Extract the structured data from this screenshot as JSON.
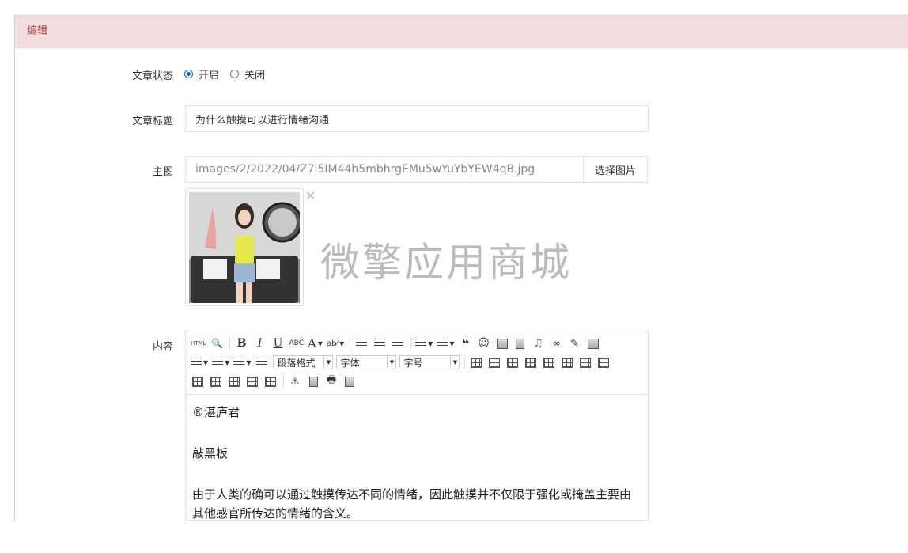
{
  "panel": {
    "title": "编辑"
  },
  "form": {
    "status": {
      "label": "文章状态",
      "options": [
        "开启",
        "关闭"
      ],
      "selected": "开启"
    },
    "title": {
      "label": "文章标题",
      "value": "为什么触摸可以进行情绪沟通"
    },
    "image": {
      "label": "主图",
      "path": "images/2/2022/04/Z7i5IM44h5mbhrgEMu5wYuYbYEW4qB.jpg",
      "choose_label": "选择图片",
      "watermark": "微擎应用商城"
    },
    "content": {
      "label": "内容",
      "toolbar": {
        "paragraph_format": "段落格式",
        "font_family": "字体",
        "font_size": "字号"
      },
      "paragraphs": [
        "®湛庐君",
        "敲黑板",
        "由于人类的确可以通过触摸传达不同的情绪，因此触摸并不仅限于强化或掩盖主要由其他感官所传达的情绪的含义。"
      ]
    }
  },
  "colors": {
    "panel_head_bg": "#f2dede",
    "panel_head_text": "#a94442",
    "radio_accent": "#0a66d6"
  }
}
